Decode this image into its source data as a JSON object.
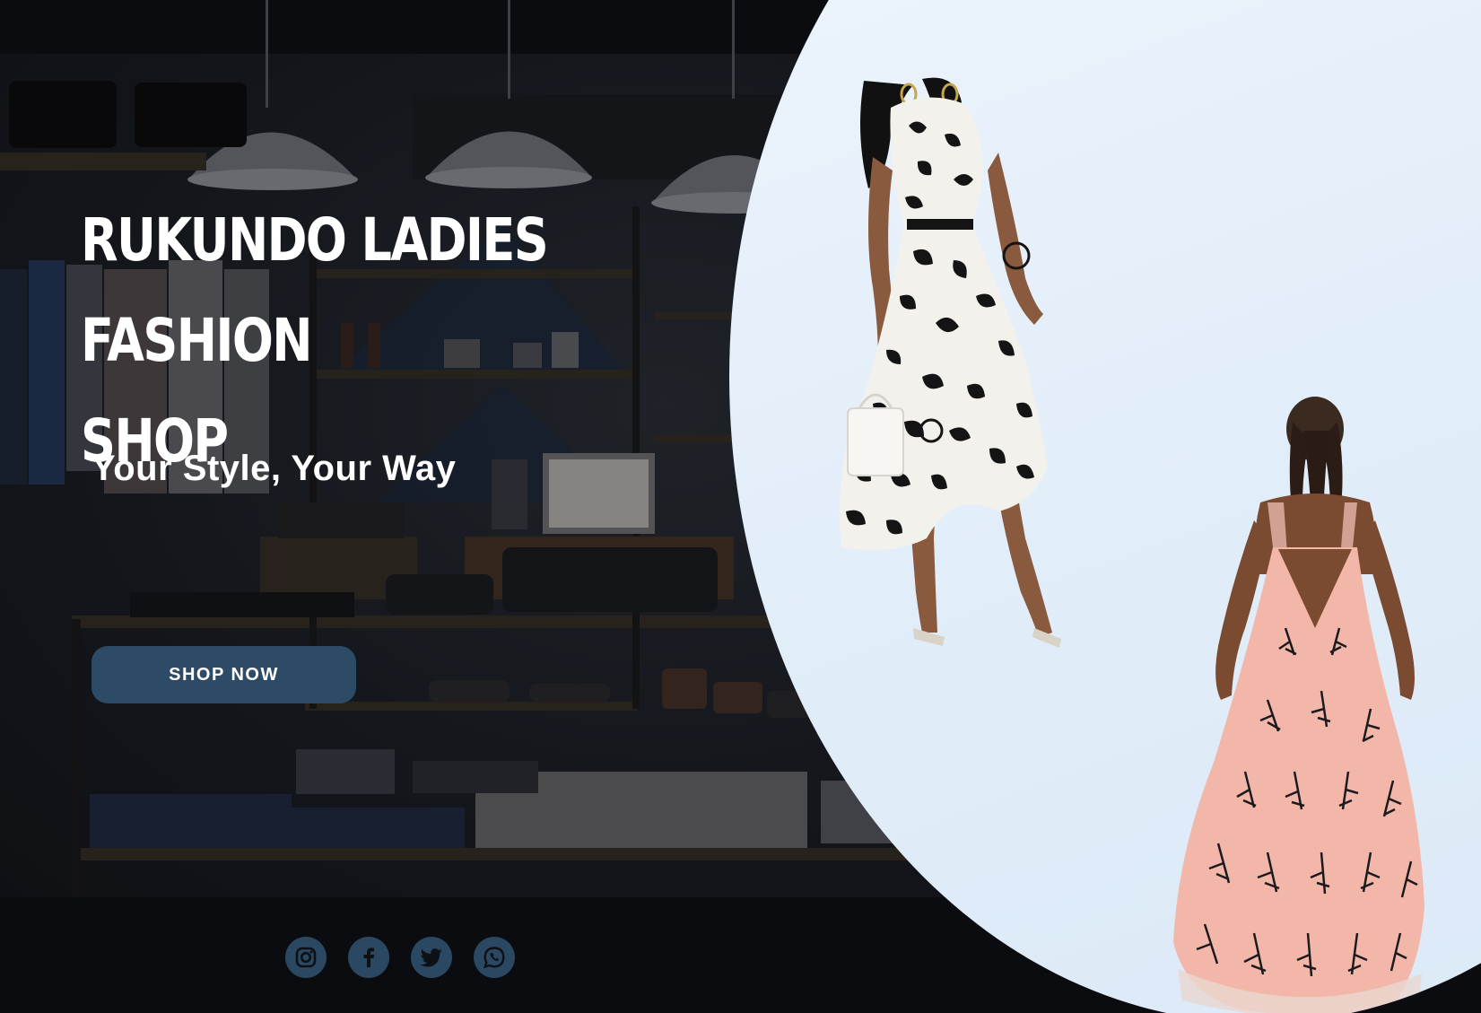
{
  "hero": {
    "title_line1": "RUKUNDO LADIES FASHION",
    "title_line2": "SHOP",
    "tagline": "Your Style, Your Way",
    "cta_label": "SHOP NOW"
  },
  "social": {
    "icons": [
      "instagram-icon",
      "facebook-icon",
      "twitter-icon",
      "whatsapp-icon"
    ]
  },
  "images": {
    "background": "clothing store interior",
    "dress_1": "black and white floral wrap dress",
    "dress_2": "pink embroidered gown"
  },
  "colors": {
    "button": "#2d4a66",
    "icon_circle": "#2b4862",
    "panel": "#e4eef9",
    "text": "#ffffff"
  }
}
